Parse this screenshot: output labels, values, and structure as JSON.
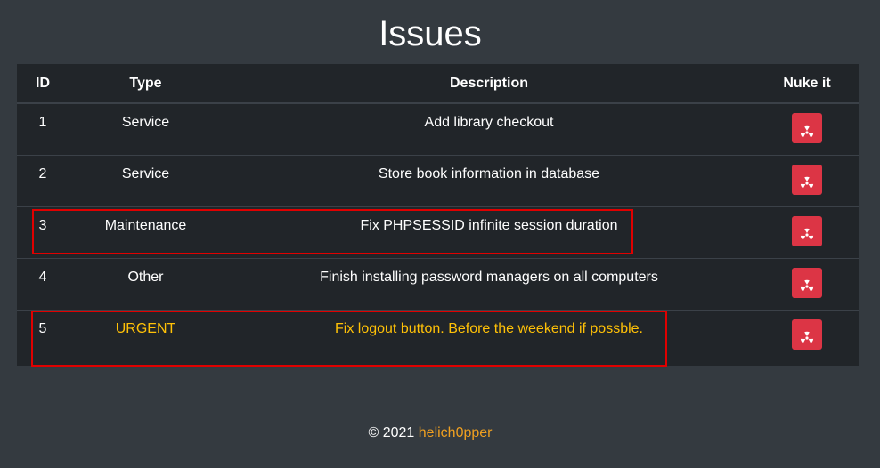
{
  "page": {
    "title": "Issues"
  },
  "table": {
    "headers": {
      "id": "ID",
      "type": "Type",
      "description": "Description",
      "nuke": "Nuke it"
    },
    "rows": [
      {
        "id": "1",
        "type": "Service",
        "description": "Add library checkout"
      },
      {
        "id": "2",
        "type": "Service",
        "description": "Store book information in database"
      },
      {
        "id": "3",
        "type": "Maintenance",
        "description": "Fix PHPSESSID infinite session duration"
      },
      {
        "id": "4",
        "type": "Other",
        "description": "Finish installing password managers on all computers"
      },
      {
        "id": "5",
        "type": "URGENT",
        "description": "Fix logout button. Before the weekend if possble."
      }
    ],
    "nuke_icon": "radiation-icon"
  },
  "footer": {
    "copyright": "© 2021",
    "author": "helich0pper"
  },
  "colors": {
    "background": "#343a40",
    "table_background": "#212529",
    "danger": "#dc3545",
    "urgent_text": "#ffc107",
    "author_link": "#f0a020",
    "highlight_box": "#e00000"
  }
}
